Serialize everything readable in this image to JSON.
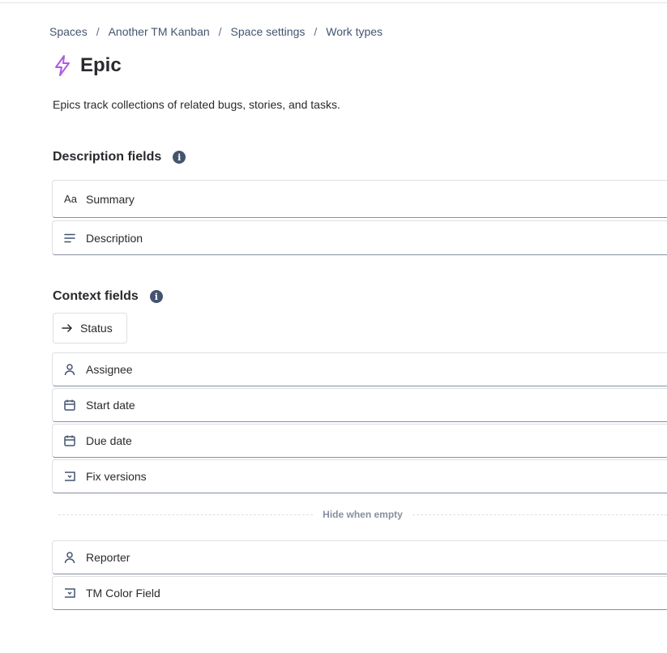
{
  "breadcrumb": {
    "items": [
      "Spaces",
      "Another TM Kanban",
      "Space settings",
      "Work types"
    ],
    "separator": "/"
  },
  "header": {
    "title": "Epic",
    "icon": "lightning-bolt-icon",
    "icon_color": "#af59e1",
    "description": "Epics track collections of related bugs, stories, and tasks."
  },
  "description_fields": {
    "heading": "Description fields",
    "items": [
      {
        "label": "Summary",
        "icon": "text-aa-icon",
        "icon_text": "Aa"
      },
      {
        "label": "Description",
        "icon": "paragraph-lines-icon"
      }
    ]
  },
  "context_fields": {
    "heading": "Context fields",
    "status_label": "Status",
    "items": [
      {
        "label": "Assignee",
        "icon": "person-icon"
      },
      {
        "label": "Start date",
        "icon": "calendar-icon"
      },
      {
        "label": "Due date",
        "icon": "calendar-icon"
      },
      {
        "label": "Fix versions",
        "icon": "dropdown-select-icon"
      }
    ],
    "hide_when_empty_label": "Hide when empty",
    "hidden_items": [
      {
        "label": "Reporter",
        "icon": "person-icon"
      },
      {
        "label": "TM Color Field",
        "icon": "dropdown-select-icon"
      }
    ]
  }
}
